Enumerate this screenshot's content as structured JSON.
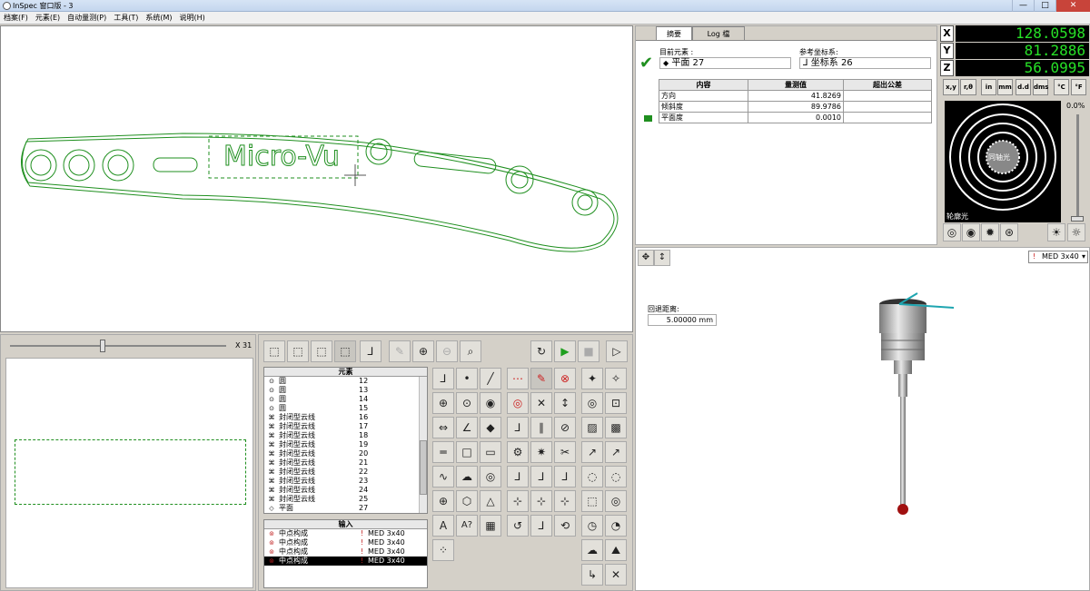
{
  "window": {
    "title": "InSpec 窗口版 - 3",
    "min": "—",
    "max": "□",
    "close": "✕"
  },
  "menu": [
    "档案(F)",
    "元素(E)",
    "自动量测(P)",
    "工具(T)",
    "系统(M)",
    "说明(H)"
  ],
  "viewer": {
    "logo_text": "Micro-Vu"
  },
  "zoom": {
    "label": "X 31",
    "value": 0.43
  },
  "tabs": {
    "summary": "摘要",
    "log": "Log 檔"
  },
  "summary": {
    "current_label": "目前元素 :",
    "current_value": "平面 27",
    "ref_label": "参考坐标系:",
    "ref_value": "坐标系 26",
    "table": {
      "headers": [
        "内容",
        "量测值",
        "超出公差"
      ],
      "rows": [
        [
          "方向",
          "41.8269",
          ""
        ],
        [
          "倾斜度",
          "89.9786",
          ""
        ],
        [
          "平面度",
          "0.0010",
          ""
        ]
      ]
    }
  },
  "dro": {
    "x_label": "X",
    "x": "128.0598",
    "y_label": "Y",
    "y": "81.2886",
    "z_label": "Z",
    "z": "56.0995"
  },
  "units": [
    "x,y",
    "r,θ",
    "in",
    "mm",
    "d.d",
    "dms",
    "°C",
    "°F"
  ],
  "light": {
    "coaxial": "同轴光",
    "contour": "轮廓光",
    "percent": "0.0%"
  },
  "probe": {
    "select": "MED 3x40",
    "retract_label": "回退距离:",
    "retract_value": "5.00000 mm"
  },
  "features": {
    "header": "元素",
    "rows": [
      {
        "name": "圆",
        "num": "12",
        "icon": "⊙"
      },
      {
        "name": "圆",
        "num": "13",
        "icon": "⊙"
      },
      {
        "name": "圆",
        "num": "14",
        "icon": "⊙"
      },
      {
        "name": "圆",
        "num": "15",
        "icon": "⊙"
      },
      {
        "name": "封闭型云线",
        "num": "16",
        "icon": "⌘"
      },
      {
        "name": "封闭型云线",
        "num": "17",
        "icon": "⌘"
      },
      {
        "name": "封闭型云线",
        "num": "18",
        "icon": "⌘"
      },
      {
        "name": "封闭型云线",
        "num": "19",
        "icon": "⌘"
      },
      {
        "name": "封闭型云线",
        "num": "20",
        "icon": "⌘"
      },
      {
        "name": "封闭型云线",
        "num": "21",
        "icon": "⌘"
      },
      {
        "name": "封闭型云线",
        "num": "22",
        "icon": "⌘"
      },
      {
        "name": "封闭型云线",
        "num": "23",
        "icon": "⌘"
      },
      {
        "name": "封闭型云线",
        "num": "24",
        "icon": "⌘"
      },
      {
        "name": "封闭型云线",
        "num": "25",
        "icon": "⌘"
      },
      {
        "name": "平面",
        "num": "27",
        "icon": "◇"
      }
    ]
  },
  "inputs": {
    "header": "输入",
    "rows": [
      {
        "name": "中点构成",
        "probe": "MED 3x40"
      },
      {
        "name": "中点构成",
        "probe": "MED 3x40"
      },
      {
        "name": "中点构成",
        "probe": "MED 3x40"
      },
      {
        "name": "中点构成",
        "probe": "MED 3x40"
      }
    ]
  },
  "colors": {
    "accent_green": "#1f8f1f",
    "dro_green": "#27e127"
  }
}
